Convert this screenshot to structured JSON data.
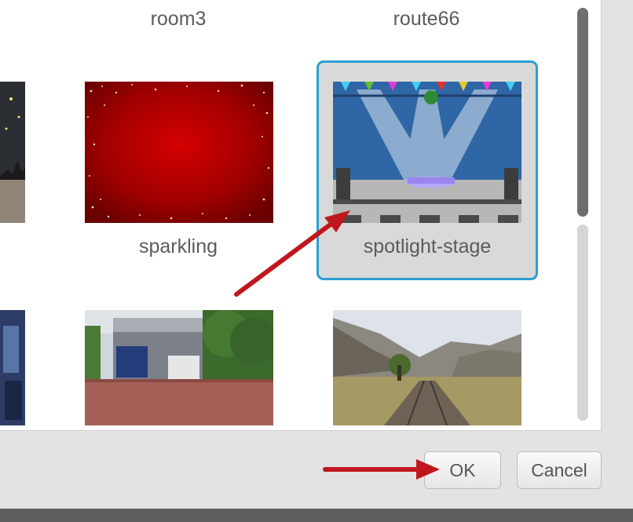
{
  "library": {
    "top_labels": [
      "room3",
      "route66"
    ],
    "items": [
      {
        "name": "sparkling",
        "selected": false
      },
      {
        "name": "spotlight-stage",
        "selected": true
      }
    ]
  },
  "buttons": {
    "ok_label": "OK",
    "cancel_label": "Cancel"
  },
  "colors": {
    "selection_border": "#2c9fd2",
    "annotation_arrow": "#c0171d"
  }
}
